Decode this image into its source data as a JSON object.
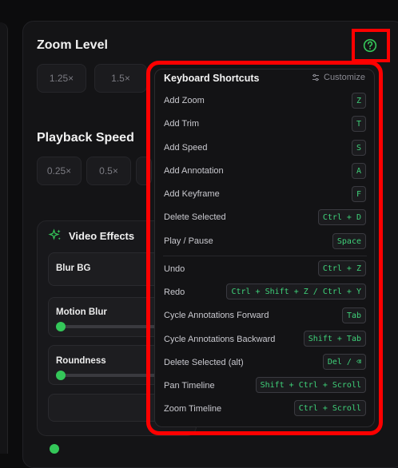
{
  "zoom": {
    "title": "Zoom Level",
    "chips": [
      "1.25×",
      "1.5×"
    ]
  },
  "playback": {
    "title": "Playback Speed",
    "chips": [
      "0.25×",
      "0.5×"
    ]
  },
  "effects": {
    "title": "Video Effects",
    "items": [
      {
        "label": "Blur BG"
      },
      {
        "label": "Motion Blur",
        "level": 0.0
      },
      {
        "label": "Roundness",
        "level": 0.0
      }
    ]
  },
  "shortcuts": {
    "title": "Keyboard Shortcuts",
    "customize_label": "Customize",
    "rows": [
      {
        "label": "Add Zoom",
        "key": "Z"
      },
      {
        "label": "Add Trim",
        "key": "T"
      },
      {
        "label": "Add Speed",
        "key": "S"
      },
      {
        "label": "Add Annotation",
        "key": "A"
      },
      {
        "label": "Add Keyframe",
        "key": "F"
      },
      {
        "label": "Delete Selected",
        "key": "Ctrl + D"
      },
      {
        "label": "Play / Pause",
        "key": "Space"
      },
      {
        "label": "Undo",
        "key": "Ctrl + Z"
      },
      {
        "label": "Redo",
        "key": "Ctrl + Shift + Z / Ctrl + Y"
      },
      {
        "label": "Cycle Annotations Forward",
        "key": "Tab"
      },
      {
        "label": "Cycle Annotations Backward",
        "key": "Shift + Tab"
      },
      {
        "label": "Delete Selected (alt)",
        "key": "Del / ⌫"
      },
      {
        "label": "Pan Timeline",
        "key": "Shift + Ctrl + Scroll"
      },
      {
        "label": "Zoom Timeline",
        "key": "Ctrl + Scroll"
      }
    ]
  },
  "colors": {
    "accent": "#34c759",
    "highlight": "#ff0000",
    "panel": "#141416"
  },
  "icons": {
    "help": "help-circle-icon",
    "customize": "sliders-icon",
    "effects": "sparkles-icon"
  }
}
